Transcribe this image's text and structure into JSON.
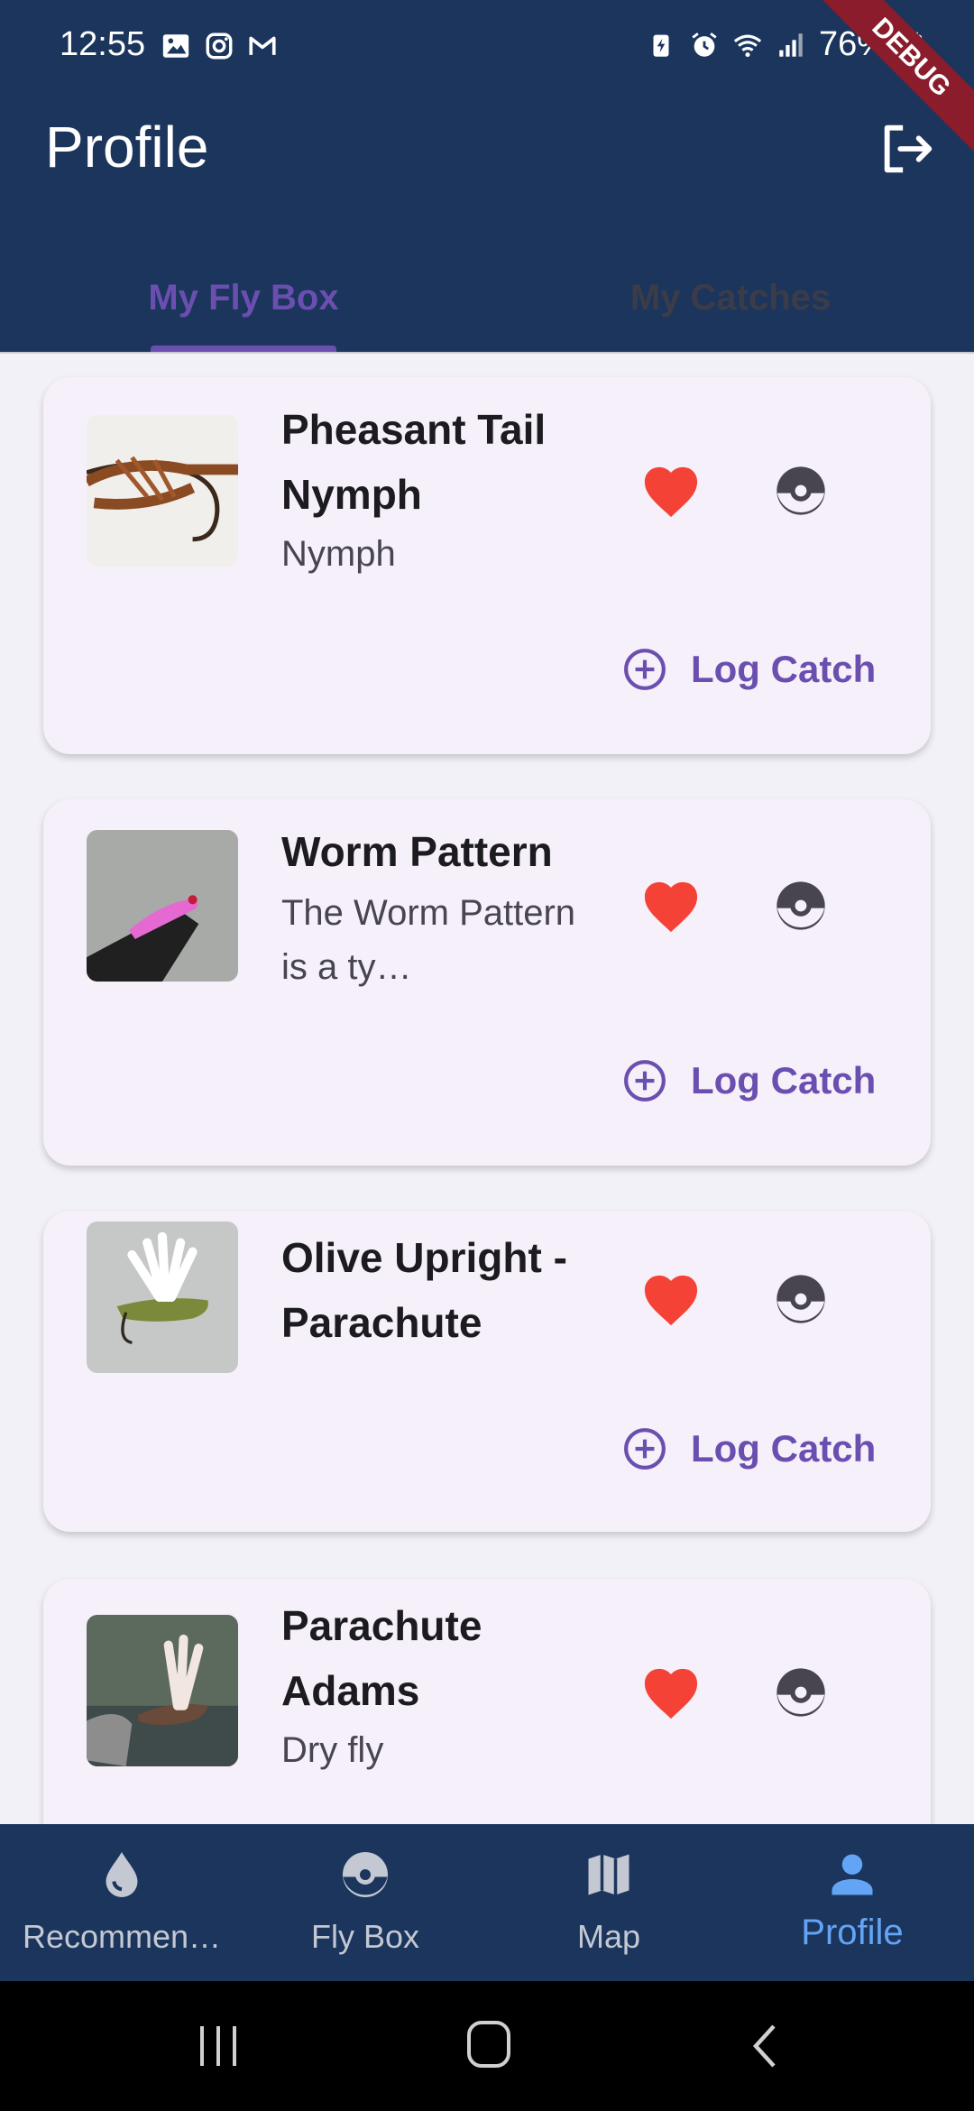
{
  "status_bar": {
    "time": "12:55",
    "battery": "76%",
    "left_icons": [
      "gallery-icon",
      "instagram-icon",
      "gmail-icon"
    ],
    "right_icons": [
      "battery-saver-icon",
      "alarm-icon",
      "wifi-icon",
      "signal-icon",
      "battery-icon"
    ]
  },
  "app_bar": {
    "title": "Profile",
    "action_icon": "logout-icon"
  },
  "tabs": [
    {
      "label": "My Fly Box",
      "active": true
    },
    {
      "label": "My Catches",
      "active": false
    }
  ],
  "flies": [
    {
      "name": "Pheasant Tail Nymph",
      "type": "Nymph",
      "favorite": true,
      "action": "Log Catch"
    },
    {
      "name": "Worm Pattern",
      "type": "The Worm Pattern is a ty…",
      "favorite": true,
      "action": "Log Catch"
    },
    {
      "name": "Olive Upright - Parachute",
      "type": "",
      "favorite": true,
      "action": "Log Catch"
    },
    {
      "name": "Parachute Adams",
      "type": "Dry fly",
      "favorite": true
    }
  ],
  "bottom_nav": [
    {
      "label": "Recommen…",
      "icon": "water-drop-icon",
      "active": false
    },
    {
      "label": "Fly Box",
      "icon": "fly-box-icon",
      "active": false
    },
    {
      "label": "Map",
      "icon": "map-icon",
      "active": false
    },
    {
      "label": "Profile",
      "icon": "person-icon",
      "active": true
    }
  ],
  "debug_banner": "DEBUG",
  "colors": {
    "app_bar": "#1b355c",
    "accent": "#6b4fb0",
    "heart": "#f44336",
    "card": "#f5f0f9",
    "nav_active": "#63a4f5"
  }
}
